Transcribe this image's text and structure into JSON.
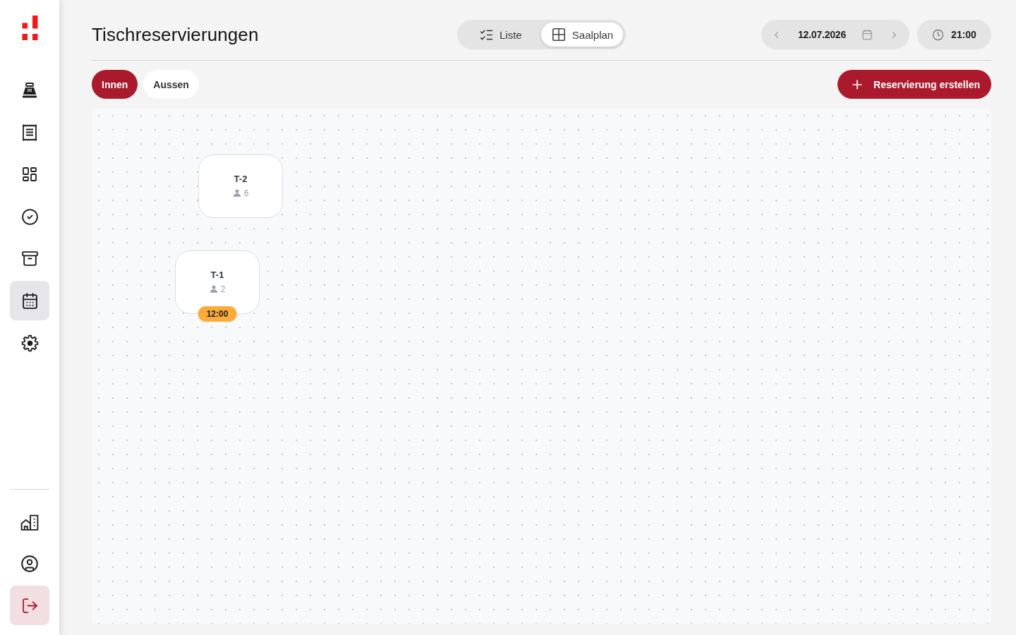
{
  "sidebar": {
    "nav_items": [
      {
        "kind": "register",
        "selected": false
      },
      {
        "kind": "receipt",
        "selected": false
      },
      {
        "kind": "dashboard",
        "selected": false
      },
      {
        "kind": "check",
        "selected": false
      },
      {
        "kind": "archive",
        "selected": false
      },
      {
        "kind": "calendar",
        "selected": true
      },
      {
        "kind": "settings",
        "selected": false
      }
    ],
    "footer_items": [
      {
        "kind": "building"
      },
      {
        "kind": "profile"
      },
      {
        "kind": "logout"
      }
    ]
  },
  "header": {
    "title": "Tischreservierungen",
    "view_tabs": [
      {
        "label": "Liste",
        "kind": "list",
        "selected": false
      },
      {
        "label": "Saalplan",
        "kind": "floorplan",
        "selected": true
      }
    ],
    "date": "12.07.2026",
    "time": "21:00"
  },
  "areas": [
    {
      "label": "Innen",
      "selected": true
    },
    {
      "label": "Aussen",
      "selected": false
    }
  ],
  "create_button": {
    "label": "Reservierung erstellen"
  },
  "floor_plan": {
    "tables": [
      {
        "name": "T-2",
        "seats": "6"
      },
      {
        "name": "T-1",
        "seats": "2",
        "reservation_time": "12:00"
      }
    ]
  }
}
